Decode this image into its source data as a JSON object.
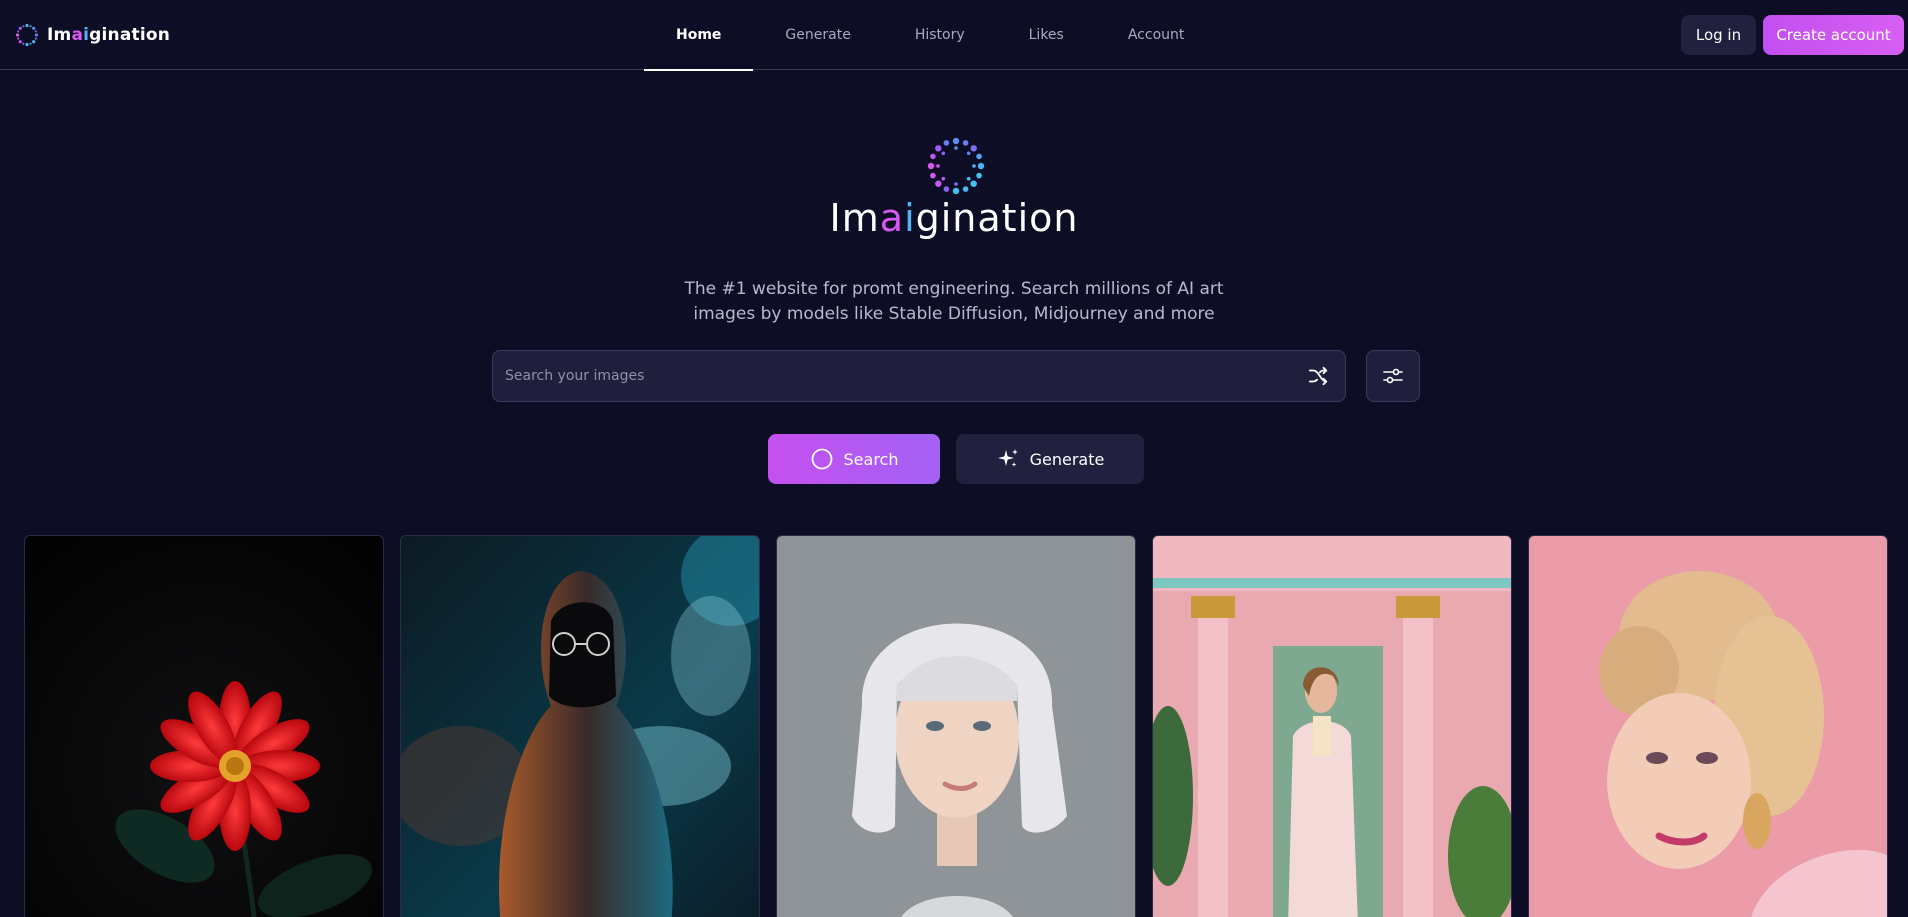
{
  "brand": {
    "name_prefix": "Im",
    "name_a": "a",
    "name_i": "i",
    "name_suffix": "gination"
  },
  "nav": {
    "items": [
      {
        "label": "Home",
        "active": true
      },
      {
        "label": "Generate",
        "active": false
      },
      {
        "label": "History",
        "active": false
      },
      {
        "label": "Likes",
        "active": false
      },
      {
        "label": "Account",
        "active": false
      }
    ]
  },
  "auth": {
    "login_label": "Log in",
    "create_label": "Create account"
  },
  "hero": {
    "title_prefix": "Im",
    "title_a": "a",
    "title_i": "i",
    "title_suffix": "gination",
    "subtitle_line1": "The #1 website for promt engineering. Search millions of AI art",
    "subtitle_line2": "images by models like Stable Diffusion, Midjourney and more"
  },
  "search": {
    "placeholder": "Search your images",
    "value": "",
    "search_label": "Search",
    "generate_label": "Generate"
  },
  "gallery": {
    "items": [
      {
        "subject": "red-flower"
      },
      {
        "subject": "hooded-figure-smoke"
      },
      {
        "subject": "white-bob-portrait"
      },
      {
        "subject": "pink-building-fashion"
      },
      {
        "subject": "blonde-updo-portrait"
      }
    ]
  },
  "colors": {
    "background": "#0e0d26",
    "accent_pink": "#d659f0",
    "accent_blue": "#4fb4f4",
    "surface": "#21213f"
  },
  "icons": [
    "logo-icon",
    "shuffle-icon",
    "filter-icon",
    "search-icon",
    "sparkle-icon"
  ]
}
